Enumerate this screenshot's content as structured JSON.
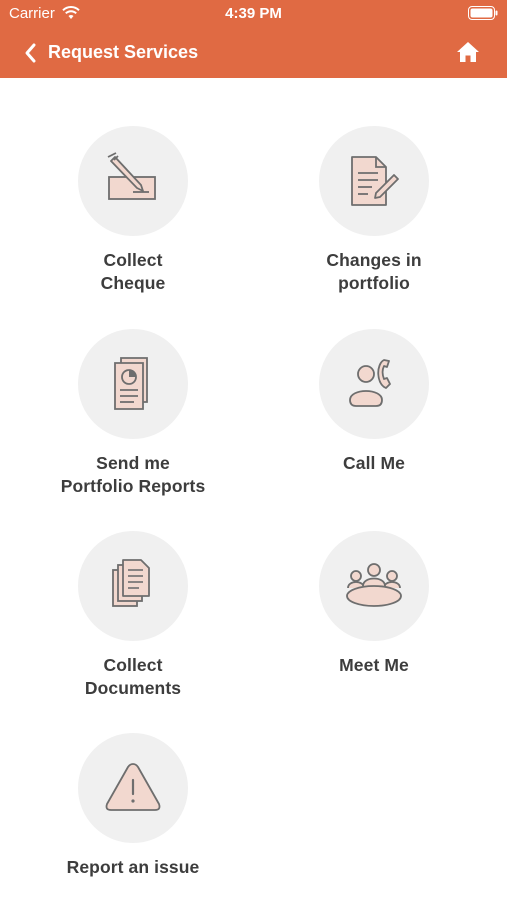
{
  "status_bar": {
    "carrier": "Carrier",
    "time": "4:39 PM"
  },
  "header": {
    "title": "Request Services",
    "back_icon": "chevron-left-icon",
    "home_icon": "home-icon"
  },
  "colors": {
    "brand": "#e06a43",
    "tile_bg": "#f0f0f0",
    "icon_fill": "#f2d8cf",
    "icon_stroke": "#6e6e6e"
  },
  "services": [
    {
      "label": "Collect\nCheque",
      "icon": "cheque-pen-icon"
    },
    {
      "label": "Changes in\nportfolio",
      "icon": "document-edit-icon"
    },
    {
      "label": "Send me\nPortfolio Reports",
      "icon": "report-chart-icon"
    },
    {
      "label": "Call Me",
      "icon": "person-phone-icon"
    },
    {
      "label": "Collect\nDocuments",
      "icon": "documents-stack-icon"
    },
    {
      "label": "Meet Me",
      "icon": "meeting-group-icon"
    },
    {
      "label": "Report an issue",
      "icon": "warning-triangle-icon"
    }
  ]
}
